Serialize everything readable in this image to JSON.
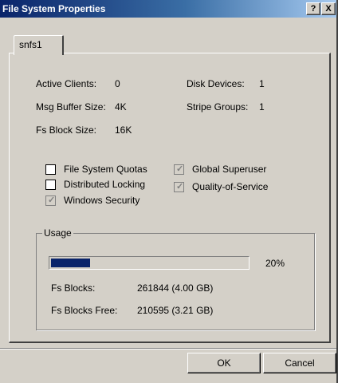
{
  "window": {
    "title": "File System Properties",
    "help_label": "?",
    "close_label": "X"
  },
  "tabs": [
    {
      "label": "snfs1"
    }
  ],
  "info": {
    "active_clients_label": "Active Clients:",
    "active_clients_value": "0",
    "disk_devices_label": "Disk Devices:",
    "disk_devices_value": "1",
    "msg_buffer_label": "Msg Buffer Size:",
    "msg_buffer_value": "4K",
    "stripe_groups_label": "Stripe Groups:",
    "stripe_groups_value": "1",
    "fs_block_label": "Fs Block Size:",
    "fs_block_value": "16K"
  },
  "options": {
    "fs_quotas": {
      "label": "File System Quotas",
      "checked": false
    },
    "distributed_locking": {
      "label": "Distributed Locking",
      "checked": false
    },
    "windows_security": {
      "label": "Windows Security",
      "checked": true
    },
    "global_superuser": {
      "label": "Global Superuser",
      "checked": true
    },
    "quality_of_service": {
      "label": "Quality-of-Service",
      "checked": true
    }
  },
  "usage": {
    "group_label": "Usage",
    "percent_text": "20%",
    "fill_fraction": 0.2,
    "fs_blocks_label": "Fs Blocks:",
    "fs_blocks_value": "261844 (4.00 GB)",
    "fs_blocks_free_label": "Fs Blocks Free:",
    "fs_blocks_free_value": "210595 (3.21 GB)",
    "bar_color": "#0a246a"
  },
  "buttons": {
    "ok_label": "OK",
    "cancel_label": "Cancel"
  },
  "icons": {
    "check": "check-icon"
  }
}
